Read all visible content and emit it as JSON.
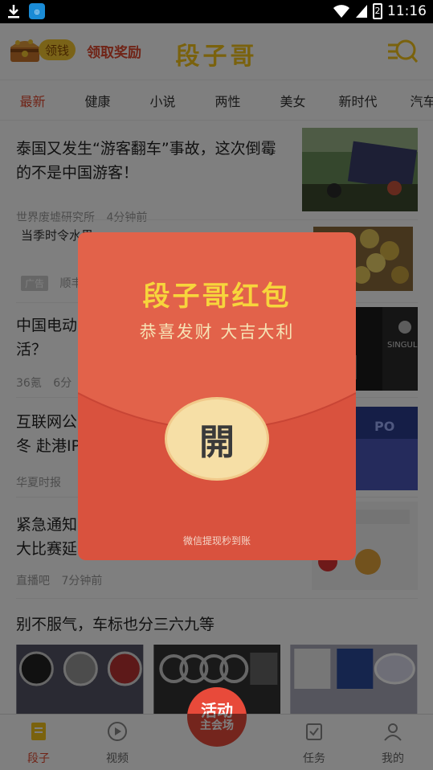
{
  "status_bar": {
    "time": "11:16",
    "battery": "2"
  },
  "header": {
    "coin_label": "领钱",
    "claim_reward": "领取奖励",
    "brand": "段子哥"
  },
  "tabs": [
    {
      "label": "最新",
      "active": true
    },
    {
      "label": "健康"
    },
    {
      "label": "小说"
    },
    {
      "label": "两性"
    },
    {
      "label": "美女"
    },
    {
      "label": "新时代"
    },
    {
      "label": "汽车"
    }
  ],
  "feed": {
    "items": [
      {
        "title": "泰国又发生“游客翻车”事故，这次倒霉的不是中国游客！",
        "source": "世界废墟研究所",
        "time": "4分钟前"
      },
      {
        "title": "当季时令水果",
        "source": "顺丰",
        "ad_tag": "广告"
      },
      {
        "title": "中国电动",
        "title2": "活？",
        "source": "36氪",
        "time": "6分"
      },
      {
        "title": "互联网公",
        "title2": "冬 赴港IP",
        "source": "华夏时报"
      },
      {
        "title": "紧急通知",
        "title2": "大比赛延",
        "source": "直播吧",
        "time": "7分钟前"
      },
      {
        "title": "别不服气，车标也分三六九等"
      }
    ]
  },
  "red_envelope": {
    "title": "段子哥红包",
    "subtitle": "恭喜发财  大吉大利",
    "open_label": "開",
    "footer": "微信提现秒到账"
  },
  "bottom_nav": {
    "items": [
      {
        "label": "段子",
        "active": true,
        "icon": "doc-icon"
      },
      {
        "label": "视频",
        "icon": "play-icon"
      },
      {
        "label": "任务",
        "icon": "checklist-icon"
      },
      {
        "label": "我的",
        "icon": "person-icon"
      }
    ],
    "activity_line1": "活动",
    "activity_line2": "主会场"
  },
  "colors": {
    "accent": "#e0492f",
    "brand_yellow": "#f5c41a",
    "envelope_red": "#d9523e"
  }
}
